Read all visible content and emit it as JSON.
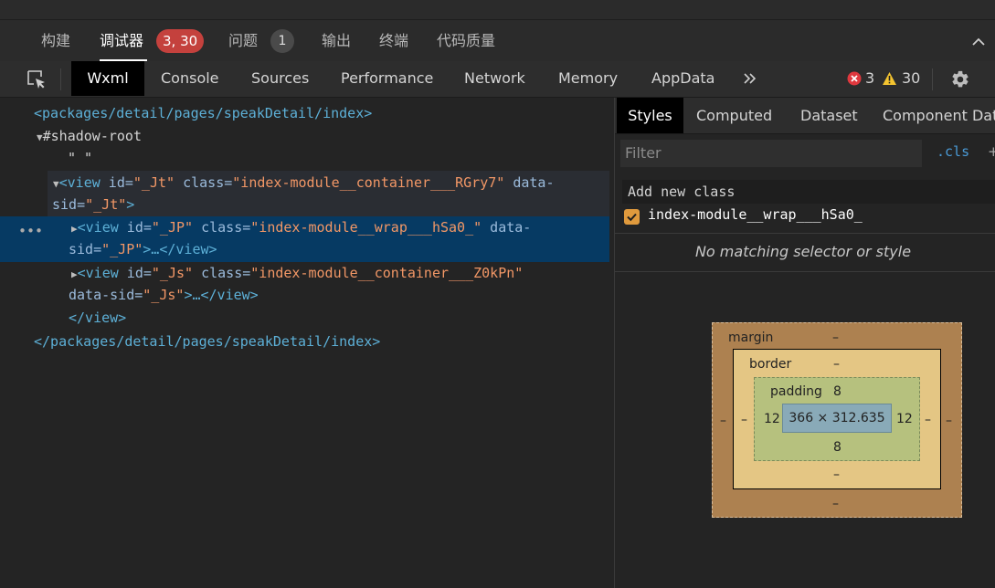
{
  "panel_tabs": [
    {
      "label": "构建"
    },
    {
      "label": "调试器",
      "badge": "3, 30"
    },
    {
      "label": "问题",
      "badge": "1"
    },
    {
      "label": "输出"
    },
    {
      "label": "终端"
    },
    {
      "label": "代码质量"
    }
  ],
  "devtools_tabs": [
    "Wxml",
    "Console",
    "Sources",
    "Performance",
    "Network",
    "Memory",
    "AppData"
  ],
  "status": {
    "errors": "3",
    "warnings": "30"
  },
  "tree": {
    "root_open": "<packages/detail/pages/speakDetail/index>",
    "shadow_root": "#shadow-root",
    "empty_text": "\" \"",
    "view1": {
      "tag_open": "<view",
      "id_attr": " id=",
      "id_val": "\"_Jt\"",
      "class_attr": " class=",
      "class_val": "\"index-module__container___RGry7\"",
      "sid_attr_a": " data-",
      "sid_attr_b": "sid=",
      "sid_val": "\"_Jt\"",
      "tag_end": ">"
    },
    "view2": {
      "tag_open": "<view",
      "id_attr": " id=",
      "id_val": "\"_JP\"",
      "class_attr": " class=",
      "class_val": "\"index-module__wrap___hSa0_\"",
      "sid_attr_a": " data-",
      "sid_attr_b": "sid=",
      "sid_val": "\"_JP\"",
      "tag_rest": ">…</view>"
    },
    "view3": {
      "tag_open": "<view",
      "id_attr": " id=",
      "id_val": "\"_Js\"",
      "class_attr": " class=",
      "class_val": "\"index-module__container___Z0kPn\"",
      "sid_attr_b": "data-sid=",
      "sid_val": "\"_Js\"",
      "tag_rest": ">…</view>"
    },
    "view_close": "</view>",
    "root_close": "</packages/detail/pages/speakDetail/index>"
  },
  "styles_panel": {
    "tabs": [
      "Styles",
      "Computed",
      "Dataset",
      "Component Data"
    ],
    "filter_placeholder": "Filter",
    "cls_button": ".cls",
    "plus_button": "+",
    "add_class_placeholder": "Add new class",
    "class_item": "index-module__wrap___hSa0_",
    "no_match": "No matching selector or style"
  },
  "box_model": {
    "margin_label": "margin",
    "margin_top": "–",
    "margin_bottom": "–",
    "margin_left": "–",
    "margin_right": "–",
    "border_label": "border",
    "border_top": "–",
    "border_bottom": "–",
    "border_left": "–",
    "border_right": "–",
    "padding_label": "padding",
    "padding_top": "8",
    "padding_bottom": "8",
    "padding_left": "12",
    "padding_right": "12",
    "content": "366 × 312.635"
  },
  "colors": {
    "accent_selection": "#063a63",
    "error_badge": "#c4413d",
    "tag": "#5db0d7",
    "attr_value": "#f29766"
  }
}
